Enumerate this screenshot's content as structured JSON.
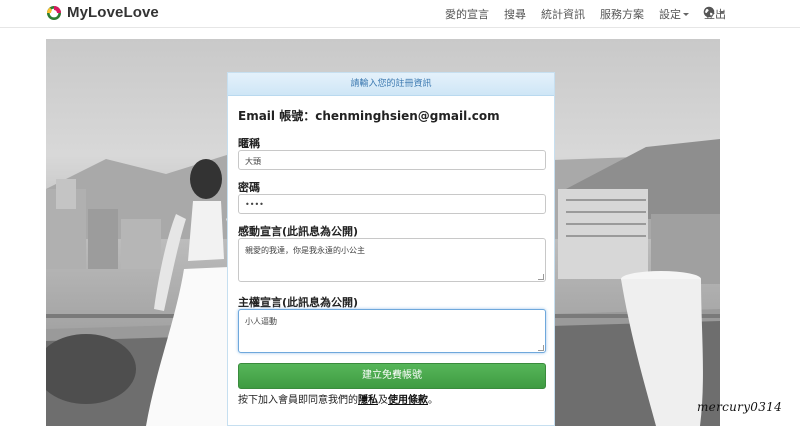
{
  "brand": {
    "name": "MyLoveLove"
  },
  "nav": {
    "items": [
      "愛的宣言",
      "搜尋",
      "統計資訊",
      "服務方案"
    ],
    "settings": "設定",
    "logout": "登出"
  },
  "panel": {
    "heading": "請輸入您的註冊資訊",
    "email_label": "Email 帳號：",
    "email_value": "chenminghsien@gmail.com",
    "nickname_label": "暱稱",
    "nickname_value": "大頭",
    "password_label": "密碼",
    "password_value": "••••",
    "declaration_label": "感動宣言(此訊息為公開)",
    "declaration_value": "親愛的我達，你是我永遠的小公主",
    "theme_label": "主權宣言(此訊息為公開)",
    "theme_value": "小人逼動",
    "submit_label": "建立免費帳號",
    "terms_prefix": "按下加入會員即同意我們的",
    "terms_privacy": "隱私",
    "terms_and": "及",
    "terms_use": "使用條款",
    "terms_suffix": "。"
  },
  "watermark": "mercury0314",
  "colors": {
    "accent_green": "#48a84c",
    "heading_blue": "#3d7ab1"
  },
  "icons": [
    "logo-icon",
    "caret-down-icon",
    "globe-icon"
  ]
}
